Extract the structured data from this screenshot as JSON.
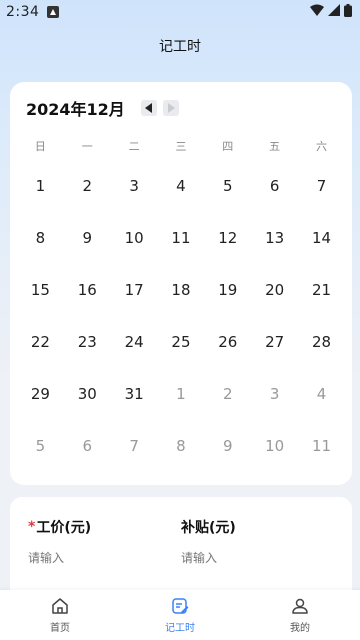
{
  "status_bar": {
    "time": "2:34"
  },
  "header": {
    "title": "记工时"
  },
  "calendar": {
    "month_label": "2024年12月",
    "weekdays": [
      "日",
      "一",
      "二",
      "三",
      "四",
      "五",
      "六"
    ],
    "weeks": [
      [
        "1",
        "2",
        "3",
        "4",
        "5",
        "6",
        "7"
      ],
      [
        "8",
        "9",
        "10",
        "11",
        "12",
        "13",
        "14"
      ],
      [
        "15",
        "16",
        "17",
        "18",
        "19",
        "20",
        "21"
      ],
      [
        "22",
        "23",
        "24",
        "25",
        "26",
        "27",
        "28"
      ],
      [
        "29",
        "30",
        "31",
        "1",
        "2",
        "3",
        "4"
      ],
      [
        "5",
        "6",
        "7",
        "8",
        "9",
        "10",
        "11"
      ]
    ]
  },
  "wage_form": {
    "wage": {
      "required_mark": "*",
      "label": "工价(元)",
      "placeholder": "请输入"
    },
    "subsidy": {
      "label": "补贴(元)",
      "placeholder": "请输入"
    }
  },
  "bottom_nav": {
    "home": "首页",
    "clock": "记工时",
    "mine": "我的"
  },
  "colors": {
    "accent": "#3b82f6",
    "required": "#e53935"
  }
}
